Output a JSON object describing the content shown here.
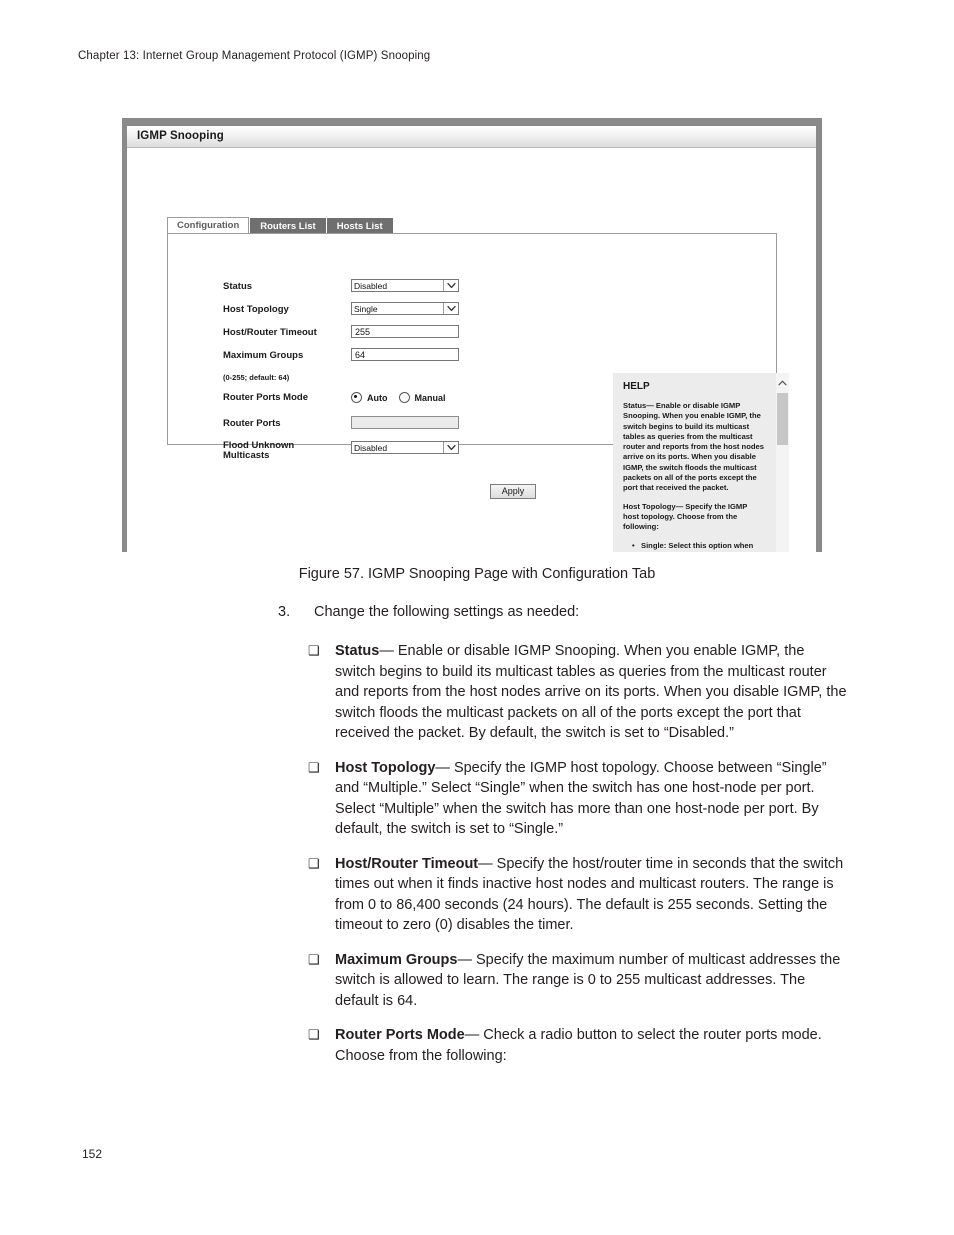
{
  "document": {
    "running_header": "Chapter 13: Internet Group Management Protocol (IGMP) Snooping",
    "page_number": "152",
    "figure_caption": "Figure 57. IGMP Snooping Page with Configuration Tab",
    "step": {
      "number": "3.",
      "text": "Change the following settings as needed:"
    },
    "bullet_marker": "❑",
    "bullets": [
      {
        "term": "Status",
        "body": "— Enable or disable IGMP Snooping. When you enable IGMP, the switch begins to build its multicast tables as queries from the multicast router and reports from the host nodes arrive on its ports. When you disable IGMP, the switch floods the multicast packets on all of the ports except the port that received the packet. By default, the switch is set to “Disabled.”"
      },
      {
        "term": "Host Topology",
        "body": "— Specify the IGMP host topology. Choose between “Single” and “Multiple.” Select “Single” when the switch has one host-node per port. Select “Multiple” when the switch has more than one host-node per port. By default, the switch is set to “Single.”"
      },
      {
        "term": "Host/Router Timeout",
        "body": "— Specify the host/router time in seconds that the switch times out when it finds inactive host nodes and multicast routers. The range is from 0 to 86,400 seconds (24 hours). The default is 255 seconds. Setting the timeout to zero (0) disables the timer."
      },
      {
        "term": "Maximum Groups",
        "body": "— Specify the maximum number of multicast addresses the switch is allowed to learn. The range is 0 to 255 multicast addresses. The default is 64."
      },
      {
        "term": "Router Ports Mode",
        "body": "— Check a radio button to select the router ports mode. Choose from the following:"
      }
    ]
  },
  "screenshot": {
    "titlebar": {
      "title": "IGMP Snooping"
    },
    "tabs": [
      {
        "label": "Configuration",
        "active": true
      },
      {
        "label": "Routers List",
        "active": false
      },
      {
        "label": "Hosts List",
        "active": false
      }
    ],
    "form": {
      "status": {
        "label": "Status",
        "value": "Disabled",
        "type": "select"
      },
      "host_topology": {
        "label": "Host Topology",
        "value": "Single",
        "type": "select"
      },
      "host_router_timeout": {
        "label": "Host/Router Timeout",
        "value": "255",
        "type": "text"
      },
      "maximum_groups": {
        "label": "Maximum Groups",
        "hint": "(0-255; default: 64)",
        "value": "64",
        "type": "text"
      },
      "router_ports_mode": {
        "label": "Router Ports Mode",
        "options": [
          "Auto",
          "Manual"
        ],
        "selected": "Auto"
      },
      "router_ports": {
        "label": "Router Ports",
        "value": "",
        "type": "text",
        "disabled": true
      },
      "flood_unknown_multicasts": {
        "label_line1": "Flood Unknown",
        "label_line2": "Multicasts",
        "value": "Disabled",
        "type": "select"
      }
    },
    "apply_button": {
      "label": "Apply"
    },
    "help": {
      "title": "HELP",
      "paragraphs": [
        {
          "term": "Status—",
          "body": " Enable or disable IGMP Snooping. When you enable IGMP, the switch begins to build its multicast tables as queries from the multicast router and reports from the host nodes arrive on its ports. When you disable IGMP, the switch floods the multicast packets on all of the ports except the port that received the packet."
        },
        {
          "term": "Host Topology—",
          "body": " Specify the IGMP host topology. Choose from the following:"
        }
      ],
      "bullets": [
        {
          "term": "Single",
          "body": ": Select this option when the switch has one-host-node per port. This is"
        }
      ]
    }
  },
  "colors": {
    "frame_gray": "#8a8a8a",
    "tab_inactive": "#6f6f6f",
    "help_bg": "#ececec",
    "text": "#231f20"
  }
}
